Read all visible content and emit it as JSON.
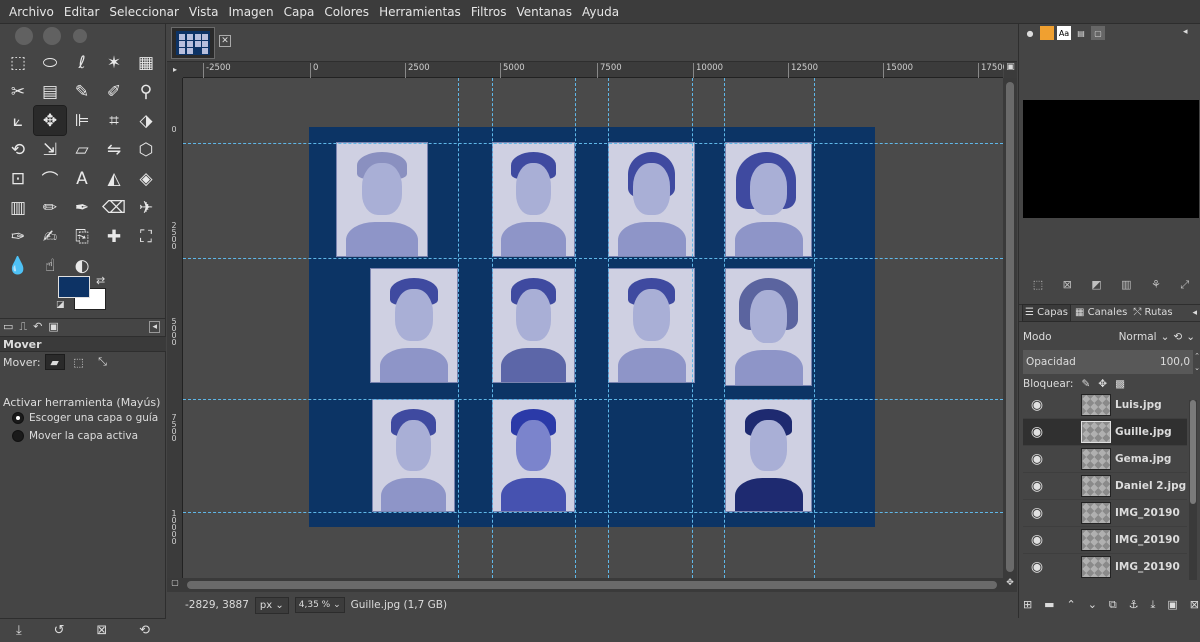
{
  "menubar": {
    "items": [
      "Archivo",
      "Editar",
      "Seleccionar",
      "Vista",
      "Imagen",
      "Capa",
      "Colores",
      "Herramientas",
      "Filtros",
      "Ventanas",
      "Ayuda"
    ]
  },
  "toolbox": {
    "tools": [
      {
        "name": "rect-select-icon",
        "glyph": "⬚"
      },
      {
        "name": "ellipse-select-icon",
        "glyph": "⬭"
      },
      {
        "name": "free-select-icon",
        "glyph": "ℓ"
      },
      {
        "name": "fuzzy-select-icon",
        "glyph": "✶"
      },
      {
        "name": "color-select-icon",
        "glyph": "▦"
      },
      {
        "name": "scissors-select-icon",
        "glyph": "✂"
      },
      {
        "name": "foreground-select-icon",
        "glyph": "▤"
      },
      {
        "name": "paths-icon",
        "glyph": "✎"
      },
      {
        "name": "color-picker-icon",
        "glyph": "✐"
      },
      {
        "name": "zoom-icon",
        "glyph": "⚲"
      },
      {
        "name": "measure-icon",
        "glyph": "⟀"
      },
      {
        "name": "move-icon",
        "glyph": "✥"
      },
      {
        "name": "align-icon",
        "glyph": "⊫"
      },
      {
        "name": "crop-icon",
        "glyph": "⌗"
      },
      {
        "name": "unified-transform-icon",
        "glyph": "⬗"
      },
      {
        "name": "rotate-icon",
        "glyph": "⟲"
      },
      {
        "name": "scale-icon",
        "glyph": "⇲"
      },
      {
        "name": "shear-icon",
        "glyph": "▱"
      },
      {
        "name": "flip-icon",
        "glyph": "⇋"
      },
      {
        "name": "perspective-icon",
        "glyph": "⬡"
      },
      {
        "name": "cage-icon",
        "glyph": "⊡"
      },
      {
        "name": "warp-icon",
        "glyph": "⌒"
      },
      {
        "name": "text-icon",
        "glyph": "A"
      },
      {
        "name": "bucket-fill-icon",
        "glyph": "◭"
      },
      {
        "name": "blend-icon",
        "glyph": "◈"
      },
      {
        "name": "gradient-icon",
        "glyph": "▥"
      },
      {
        "name": "pencil-icon",
        "glyph": "✏"
      },
      {
        "name": "paintbrush-icon",
        "glyph": "✒"
      },
      {
        "name": "eraser-icon",
        "glyph": "⌫"
      },
      {
        "name": "airbrush-icon",
        "glyph": "✈"
      },
      {
        "name": "ink-icon",
        "glyph": "✑"
      },
      {
        "name": "mypaint-brush-icon",
        "glyph": "✍"
      },
      {
        "name": "clone-icon",
        "glyph": "⎘"
      },
      {
        "name": "heal-icon",
        "glyph": "✚"
      },
      {
        "name": "perspective-clone-icon",
        "glyph": "⛶"
      },
      {
        "name": "blur-icon",
        "glyph": "💧"
      },
      {
        "name": "smudge-icon",
        "glyph": "☝"
      },
      {
        "name": "dodge-burn-icon",
        "glyph": "◐"
      }
    ],
    "active_tool_index": 11,
    "fg_color": "#0d3365",
    "bg_color": "#ffffff",
    "options": {
      "title": "Mover",
      "mover_label": "Mover:",
      "activar_label": "Activar herramienta  (Mayús)",
      "radio1": "Escoger una capa o guía",
      "radio2": "Mover la capa activa"
    }
  },
  "ruler": {
    "h_labels": [
      "-2500",
      "0",
      "2500",
      "5000",
      "7500",
      "10000",
      "12500",
      "15000",
      "17500"
    ],
    "v_labels": [
      "0",
      "2500",
      "5000",
      "7500",
      "10000"
    ]
  },
  "status": {
    "coords": "-2829, 3887",
    "unit": "px",
    "zoom": "4,35 %",
    "info": "Guille.jpg (1,7 GB)"
  },
  "right_panel": {
    "dock_tabs": [
      "Capas",
      "Canales",
      "Rutas"
    ],
    "mode_label": "Modo",
    "mode_value": "Normal",
    "opacity_label": "Opacidad",
    "opacity_value": "100,0",
    "lock_label": "Bloquear:",
    "layers": [
      {
        "name": "Luis.jpg",
        "selected": false
      },
      {
        "name": "Guille.jpg",
        "selected": true
      },
      {
        "name": "Gema.jpg",
        "selected": false
      },
      {
        "name": "Daniel 2.jpg",
        "selected": false
      },
      {
        "name": "IMG_20190",
        "selected": false
      },
      {
        "name": "IMG_20190",
        "selected": false
      },
      {
        "name": "IMG_20190",
        "selected": false
      }
    ]
  }
}
